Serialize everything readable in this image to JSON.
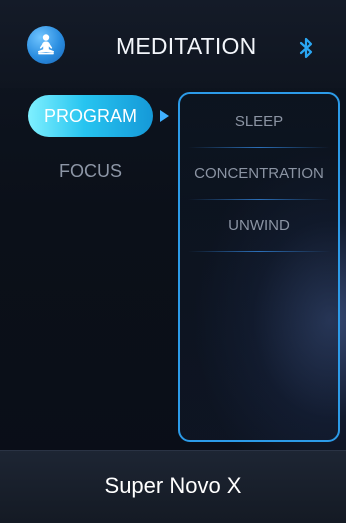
{
  "header": {
    "title": "MEDITATION",
    "logo_icon": "meditation-person-icon",
    "status_icon": "bluetooth-icon",
    "accent_color": "#2c9be8"
  },
  "menu": {
    "items": [
      {
        "label": "PROGRAM",
        "selected": true
      },
      {
        "label": "FOCUS",
        "selected": false
      }
    ]
  },
  "programs": {
    "options": [
      {
        "label": "SLEEP"
      },
      {
        "label": "CONCENTRATION"
      },
      {
        "label": "UNWIND"
      }
    ]
  },
  "footer": {
    "device_name": "Super Novo X"
  }
}
